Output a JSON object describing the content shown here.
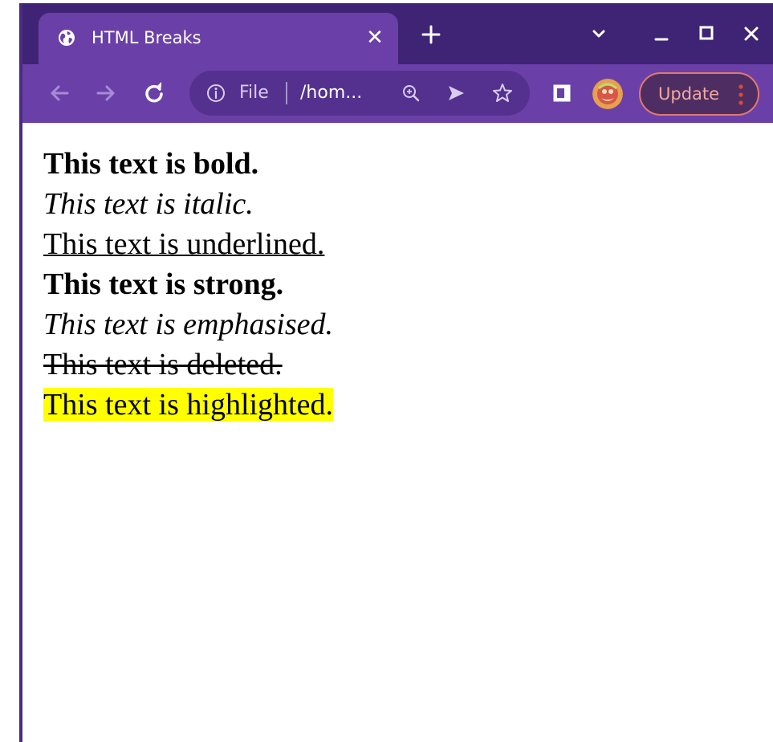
{
  "tab": {
    "title": "HTML Breaks",
    "icon": "globe-icon"
  },
  "omnibox": {
    "scheme_label": "File",
    "url_text": "/hom..."
  },
  "toolbar": {
    "update_label": "Update"
  },
  "page": {
    "lines": [
      "This text is bold.",
      "This text is italic.",
      "This text is underlined.",
      "This text is strong.",
      "This text is emphasised.",
      "This text is deleted.",
      "This text is highlighted."
    ]
  },
  "colors": {
    "tabstrip": "#3f2476",
    "toolbar": "#6a40a8",
    "omnibox": "#54308f",
    "update_border": "#e0796f",
    "highlight": "#ffff00"
  }
}
